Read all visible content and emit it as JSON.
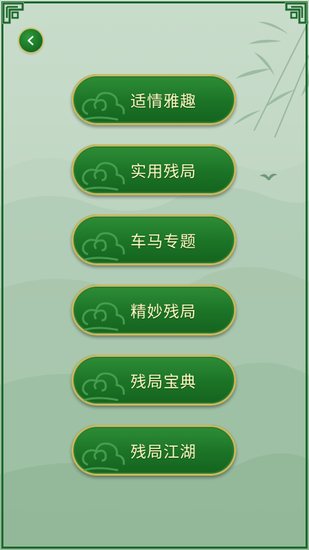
{
  "nav": {
    "back_icon": "chevron-left-icon"
  },
  "menu": {
    "items": [
      {
        "label": "适情雅趣"
      },
      {
        "label": "实用残局"
      },
      {
        "label": "车马专题"
      },
      {
        "label": "精妙残局"
      },
      {
        "label": "残局宝典"
      },
      {
        "label": "残局江湖"
      }
    ]
  },
  "colors": {
    "frame": "#1c6a2c",
    "button": "#1b7326",
    "button_border": "#cbb75e",
    "button_text": "#fff7c2",
    "background": "#c9dccb"
  }
}
